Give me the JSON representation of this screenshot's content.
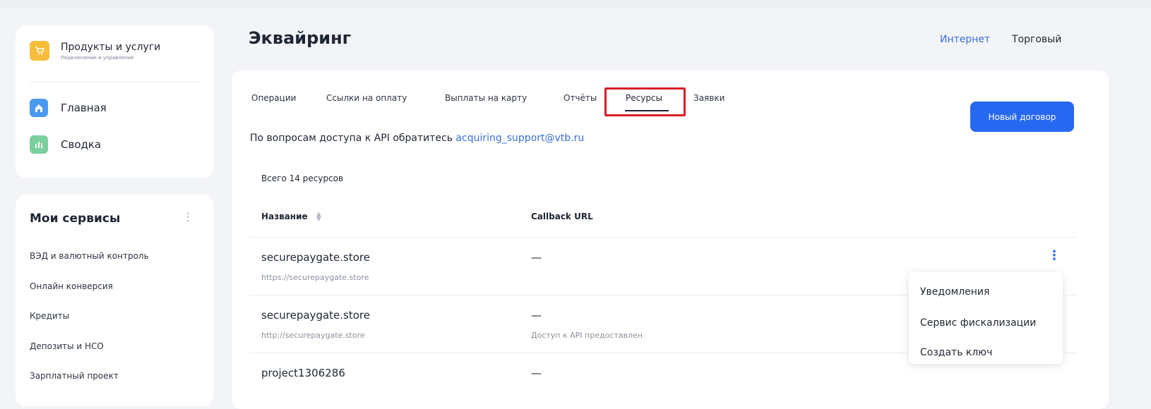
{
  "sidebar": {
    "product": {
      "title": "Продукты и услуги",
      "subtitle": "Подключение и управление",
      "icon": "cart-icon"
    },
    "nav": [
      {
        "label": "Главная",
        "icon": "home-icon"
      },
      {
        "label": "Сводка",
        "icon": "chart-icon"
      }
    ],
    "services": {
      "title": "Мои сервисы",
      "items": [
        "ВЭД и валютный контроль",
        "Онлайн конверсия",
        "Кредиты",
        "Депозиты и НСО",
        "Зарплатный проект"
      ]
    }
  },
  "header": {
    "title": "Эквайринг",
    "links": [
      "Интернет",
      "Торговый"
    ]
  },
  "tabs": [
    "Операции",
    "Ссылки на оплату",
    "Выплаты на карту",
    "Отчёты",
    "Ресурсы",
    "Заявки"
  ],
  "active_tab": "Ресурсы",
  "new_contract_button": "Новый договор",
  "api_notice": {
    "text": "По вопросам доступа к API обратитесь",
    "email": "acquiring_support@vtb.ru"
  },
  "total_label": "Всего 14 ресурсов",
  "table": {
    "columns": [
      "Название",
      "Callback URL"
    ],
    "rows": [
      {
        "name": "securepaygate.store",
        "url": "https://securepaygate.store",
        "callback": "—",
        "status": ""
      },
      {
        "name": "securepaygate.store",
        "url": "http://securepaygate.store",
        "callback": "—",
        "status": "Доступ к API предоставлен"
      },
      {
        "name": "project1306286",
        "url": "",
        "callback": "—",
        "status": ""
      }
    ]
  },
  "row_menu": [
    "Уведомления",
    "Сервис фискализации",
    "Создать ключ"
  ],
  "colors": {
    "accent": "#2768f0",
    "highlight": "#d71f2a",
    "link": "#3b6fd9"
  }
}
